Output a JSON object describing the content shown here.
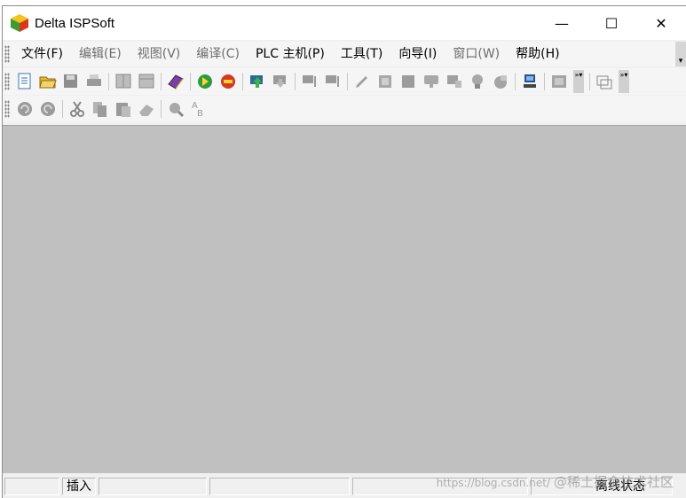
{
  "window": {
    "title": "Delta ISPSoft"
  },
  "title_buttons": {
    "minimize": "—",
    "maximize": "☐",
    "close": "✕"
  },
  "menu": [
    {
      "label": "文件(F)",
      "state": "enabled"
    },
    {
      "label": "编辑(E)",
      "state": "disabled"
    },
    {
      "label": "视图(V)",
      "state": "disabled"
    },
    {
      "label": "编译(C)",
      "state": "disabled"
    },
    {
      "label": "PLC 主机(P)",
      "state": "enabled"
    },
    {
      "label": "工具(T)",
      "state": "enabled"
    },
    {
      "label": "向导(I)",
      "state": "enabled"
    },
    {
      "label": "窗口(W)",
      "state": "disabled"
    },
    {
      "label": "帮助(H)",
      "state": "enabled"
    }
  ],
  "toolbar1": [
    "new-file-icon",
    "open-folder-icon",
    "save-icon",
    "print-icon",
    "sep",
    "split-view-icon",
    "panel-view-icon",
    "sep",
    "book-icon",
    "sep",
    "run-icon",
    "stop-icon",
    "sep",
    "upload-icon",
    "download-icon",
    "sep",
    "monitor-on-icon",
    "monitor-off-icon",
    "sep",
    "edit-pen-icon",
    "edit-table-icon",
    "edit-grid-icon",
    "comment-icon",
    "device-comment-icon",
    "bulb-icon",
    "device-list-icon",
    "sep",
    "network-icon",
    "sep",
    "communication-icon",
    "overflow",
    "sep",
    "window-icon",
    "overflow"
  ],
  "toolbar2": [
    "undo-icon",
    "redo-icon",
    "sep",
    "cut-icon",
    "copy-icon",
    "paste-icon",
    "erase-icon",
    "sep",
    "find-icon",
    "replace-icon"
  ],
  "statusbar": {
    "cell1": "",
    "mode": "插入",
    "cell3": "",
    "cell4": "",
    "cell5": "",
    "connection": "离线状态"
  },
  "watermark": {
    "prefix": "https://blog.csdn.net/",
    "text": "@稀土掘金技术社区"
  },
  "colors": {
    "workspace": "#c0c0c0",
    "titlebar": "#ffffff",
    "menubar": "#f5f5f5",
    "disabled_text": "#6d6d6d"
  }
}
